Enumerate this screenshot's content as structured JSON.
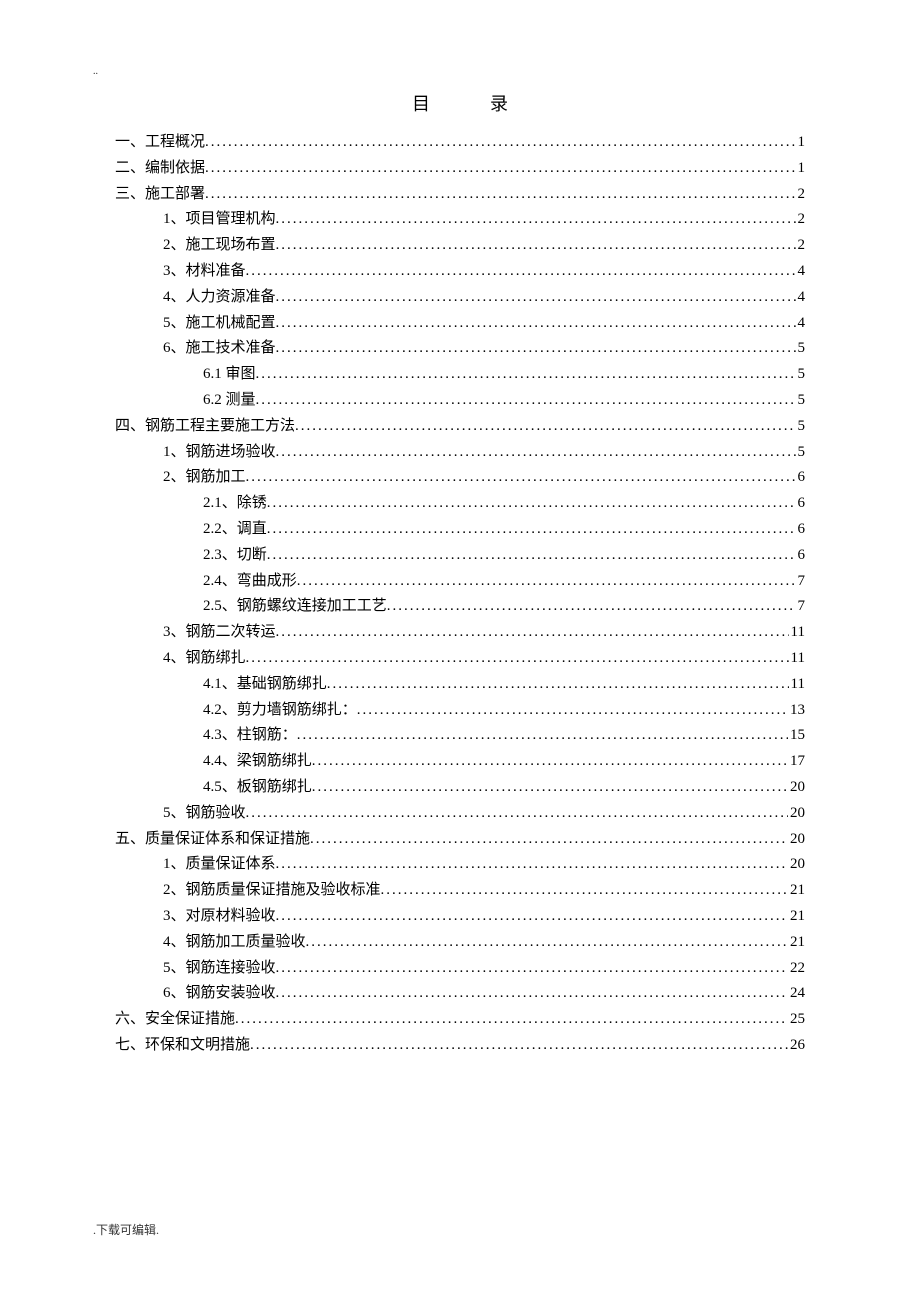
{
  "page_marker": "..",
  "title": "目录",
  "footer": ".下载可编辑.",
  "toc": [
    {
      "level": 0,
      "label": "一、工程概况",
      "page": "1"
    },
    {
      "level": 0,
      "label": "二、编制依据",
      "page": "1"
    },
    {
      "level": 0,
      "label": "三、施工部署",
      "page": "2"
    },
    {
      "level": 1,
      "label": "1、项目管理机构",
      "page": "2"
    },
    {
      "level": 1,
      "label": "2、施工现场布置",
      "page": "2"
    },
    {
      "level": 1,
      "label": "3、材料准备",
      "page": "4"
    },
    {
      "level": 1,
      "label": "4、人力资源准备",
      "page": "4"
    },
    {
      "level": 1,
      "label": "5、施工机械配置",
      "page": "4"
    },
    {
      "level": 1,
      "label": "6、施工技术准备",
      "page": "5"
    },
    {
      "level": 2,
      "label": "6.1 审图",
      "page": "5"
    },
    {
      "level": 2,
      "label": "6.2 测量",
      "page": "5"
    },
    {
      "level": 0,
      "label": "四、钢筋工程主要施工方法",
      "page": "5"
    },
    {
      "level": 1,
      "label": "1、钢筋进场验收",
      "page": "5"
    },
    {
      "level": 1,
      "label": "2、钢筋加工",
      "page": "6"
    },
    {
      "level": 2,
      "label": "2.1、除锈",
      "page": "6"
    },
    {
      "level": 2,
      "label": "2.2、调直",
      "page": "6"
    },
    {
      "level": 2,
      "label": "2.3、切断",
      "page": "6"
    },
    {
      "level": 2,
      "label": "2.4、弯曲成形",
      "page": "7"
    },
    {
      "level": 2,
      "label": "2.5、钢筋螺纹连接加工工艺",
      "page": "7"
    },
    {
      "level": 1,
      "label": "3、钢筋二次转运",
      "page": "11"
    },
    {
      "level": 1,
      "label": "4、钢筋绑扎",
      "page": "11"
    },
    {
      "level": 2,
      "label": "4.1、基础钢筋绑扎",
      "page": "11"
    },
    {
      "level": 2,
      "label": "4.2、剪力墙钢筋绑扎：",
      "page": "13"
    },
    {
      "level": 2,
      "label": "4.3、柱钢筋：",
      "page": "15"
    },
    {
      "level": 2,
      "label": "4.4、梁钢筋绑扎",
      "page": "17"
    },
    {
      "level": 2,
      "label": "4.5、板钢筋绑扎",
      "page": "20"
    },
    {
      "level": 1,
      "label": "5、钢筋验收",
      "page": "20"
    },
    {
      "level": 0,
      "label": "五、质量保证体系和保证措施",
      "page": "20"
    },
    {
      "level": 1,
      "label": "1、质量保证体系",
      "page": "20"
    },
    {
      "level": 1,
      "label": "2、钢筋质量保证措施及验收标准",
      "page": "21"
    },
    {
      "level": 1,
      "label": "3、对原材料验收",
      "page": "21"
    },
    {
      "level": 1,
      "label": "4、钢筋加工质量验收",
      "page": "21"
    },
    {
      "level": 1,
      "label": "5、钢筋连接验收",
      "page": "22"
    },
    {
      "level": 1,
      "label": "6、钢筋安装验收",
      "page": "24"
    },
    {
      "level": 0,
      "label": "六、安全保证措施",
      "page": "25"
    },
    {
      "level": 0,
      "label": "七、环保和文明措施",
      "page": "26"
    }
  ]
}
